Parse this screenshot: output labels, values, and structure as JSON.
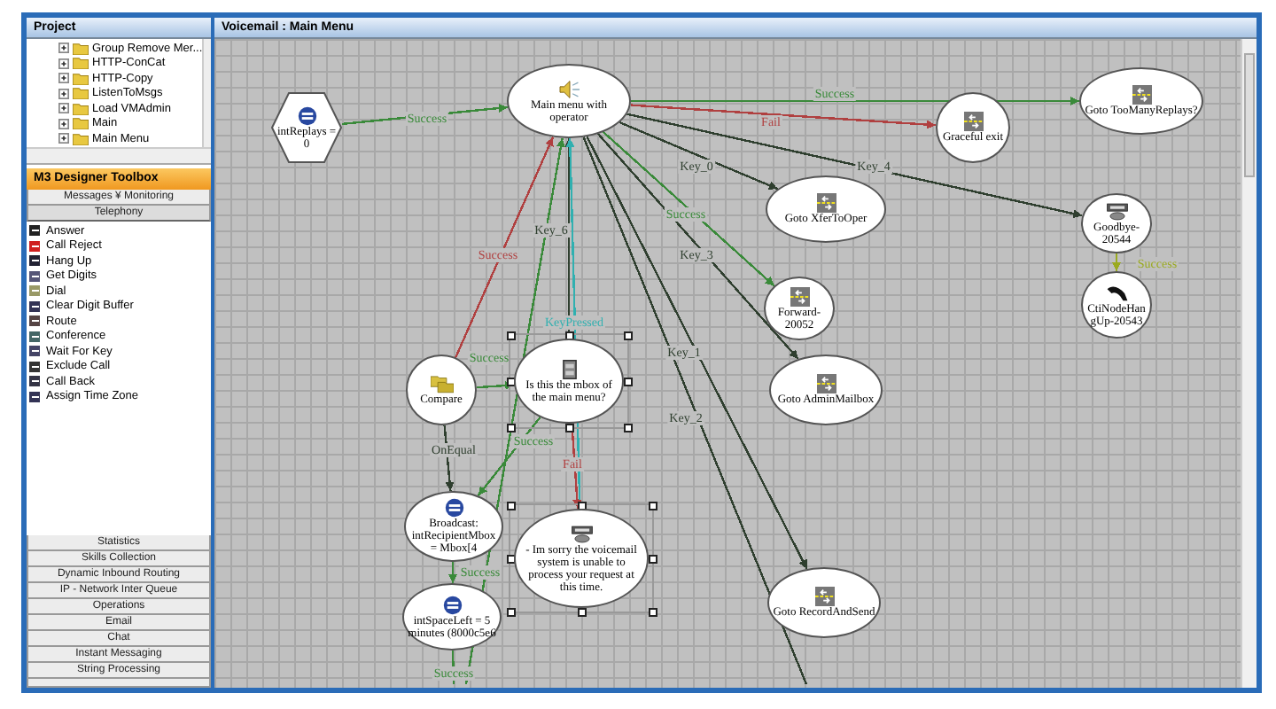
{
  "project": {
    "title": "Project",
    "tree": [
      {
        "label": "Group Remove Mer..."
      },
      {
        "label": "HTTP-ConCat"
      },
      {
        "label": "HTTP-Copy"
      },
      {
        "label": "ListenToMsgs"
      },
      {
        "label": "Load VMAdmin"
      },
      {
        "label": "Main"
      },
      {
        "label": "Main Menu"
      }
    ]
  },
  "toolbox": {
    "title": "M3 Designer Toolbox",
    "sections": [
      {
        "label": "Messages ¥ Monitoring",
        "selected": false
      },
      {
        "label": "Telephony",
        "selected": true
      },
      {
        "label": "Statistics",
        "selected": false
      },
      {
        "label": "Skills Collection",
        "selected": false
      },
      {
        "label": "Dynamic Inbound Routing",
        "selected": false
      },
      {
        "label": "IP - Network Inter Queue",
        "selected": false
      },
      {
        "label": "Operations",
        "selected": false
      },
      {
        "label": "Email",
        "selected": false
      },
      {
        "label": "Chat",
        "selected": false
      },
      {
        "label": "Instant Messaging",
        "selected": false
      },
      {
        "label": "String Processing",
        "selected": false
      }
    ],
    "items": [
      "Answer",
      "Call Reject",
      "Hang Up",
      "Get Digits",
      "Dial",
      "Clear Digit Buffer",
      "Route",
      "Conference",
      "Wait For Key",
      "Exclude Call",
      "Call Back",
      "Assign Time Zone"
    ]
  },
  "editor": {
    "title": "Voicemail : Main Menu",
    "nodes": [
      {
        "label": "intReplays = 0",
        "kind": "start",
        "selected": false
      },
      {
        "label": "Main menu with operator",
        "kind": "menu",
        "selected": false
      },
      {
        "label": "Graceful exit",
        "kind": "goto",
        "selected": false
      },
      {
        "label": "Goto TooManyReplays?",
        "kind": "goto",
        "selected": false
      },
      {
        "label": "Goto XferToOper",
        "kind": "goto",
        "selected": false
      },
      {
        "label": "Goodbye-20544",
        "kind": "message",
        "selected": false
      },
      {
        "label": "Forward-20052",
        "kind": "goto",
        "selected": false
      },
      {
        "label": "CtiNodeHangUp-20543",
        "kind": "hangup",
        "selected": false
      },
      {
        "label": "Goto AdminMailbox",
        "kind": "goto",
        "selected": false
      },
      {
        "label": "Goto RecordAndSend",
        "kind": "goto",
        "selected": false
      },
      {
        "label": "Compare",
        "kind": "compare",
        "selected": false
      },
      {
        "label": "Is this the mbox of the main menu?",
        "kind": "query",
        "selected": true
      },
      {
        "label": "Broadcast: intRecipientMbox = Mbox[4",
        "kind": "assign",
        "selected": false
      },
      {
        "label": "- Im sorry the voicemail system is unable to process your request at this time.",
        "kind": "message",
        "selected": true
      },
      {
        "label": "intSpaceLeft = 5 minutes (8000c5e6",
        "kind": "assign",
        "selected": false
      }
    ],
    "edges": [
      {
        "label": "Success",
        "color": "#3a8a3a"
      },
      {
        "label": "Success",
        "color": "#3a8a3a"
      },
      {
        "label": "Fail",
        "color": "#b04040"
      },
      {
        "label": "Key_0",
        "color": "#2f3f2f"
      },
      {
        "label": "Key_4",
        "color": "#2f3f2f"
      },
      {
        "label": "Success",
        "color": "#3a8a3a"
      },
      {
        "label": "Key_3",
        "color": "#2f3f2f"
      },
      {
        "label": "Key_1",
        "color": "#2f3f2f"
      },
      {
        "label": "Key_2",
        "color": "#2f3f2f"
      },
      {
        "label": "Key_6",
        "color": "#2f3f2f"
      },
      {
        "label": "KeyPressed",
        "color": "#30b0b0"
      },
      {
        "label": "Success",
        "color": "#b04040"
      },
      {
        "color": "#3a8a3a"
      },
      {
        "label": "Success",
        "color": "#3a8a3a"
      },
      {
        "label": "Success",
        "color": "#3a8a3a"
      },
      {
        "label": "Fail",
        "color": "#b04040"
      },
      {
        "label": "OnEqual",
        "color": "#2f3f2f"
      },
      {
        "label": "Success",
        "color": "#3a8a3a"
      },
      {
        "label": "Success",
        "color": "#3a8a3a"
      },
      {
        "label": "Success",
        "color": "#9aaa20"
      }
    ]
  }
}
